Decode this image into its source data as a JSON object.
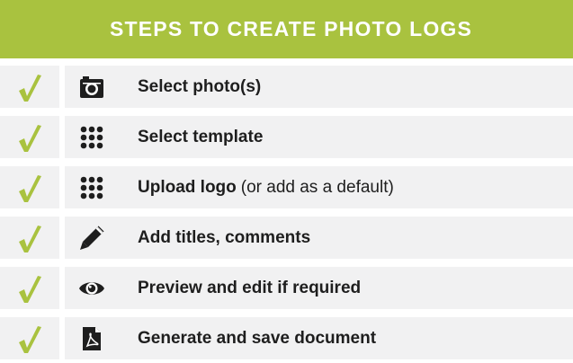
{
  "header": {
    "title": "STEPS TO CREATE PHOTO LOGS"
  },
  "colors": {
    "accent": "#a9c23f",
    "check": "#a9c23f",
    "row_background": "#f1f1f2",
    "text": "#1e1e1e"
  },
  "steps": [
    {
      "label": "Select photo(s)",
      "icon": "camera-icon"
    },
    {
      "label": "Select template",
      "icon": "grid-dots-icon"
    },
    {
      "label": "Upload logo",
      "note": "(or add as a default)",
      "icon": "grid-dots-icon"
    },
    {
      "label": "Add titles, comments",
      "icon": "pencil-icon"
    },
    {
      "label": "Preview and edit if required",
      "icon": "eye-icon"
    },
    {
      "label": "Generate and save document",
      "icon": "pdf-file-icon"
    }
  ]
}
